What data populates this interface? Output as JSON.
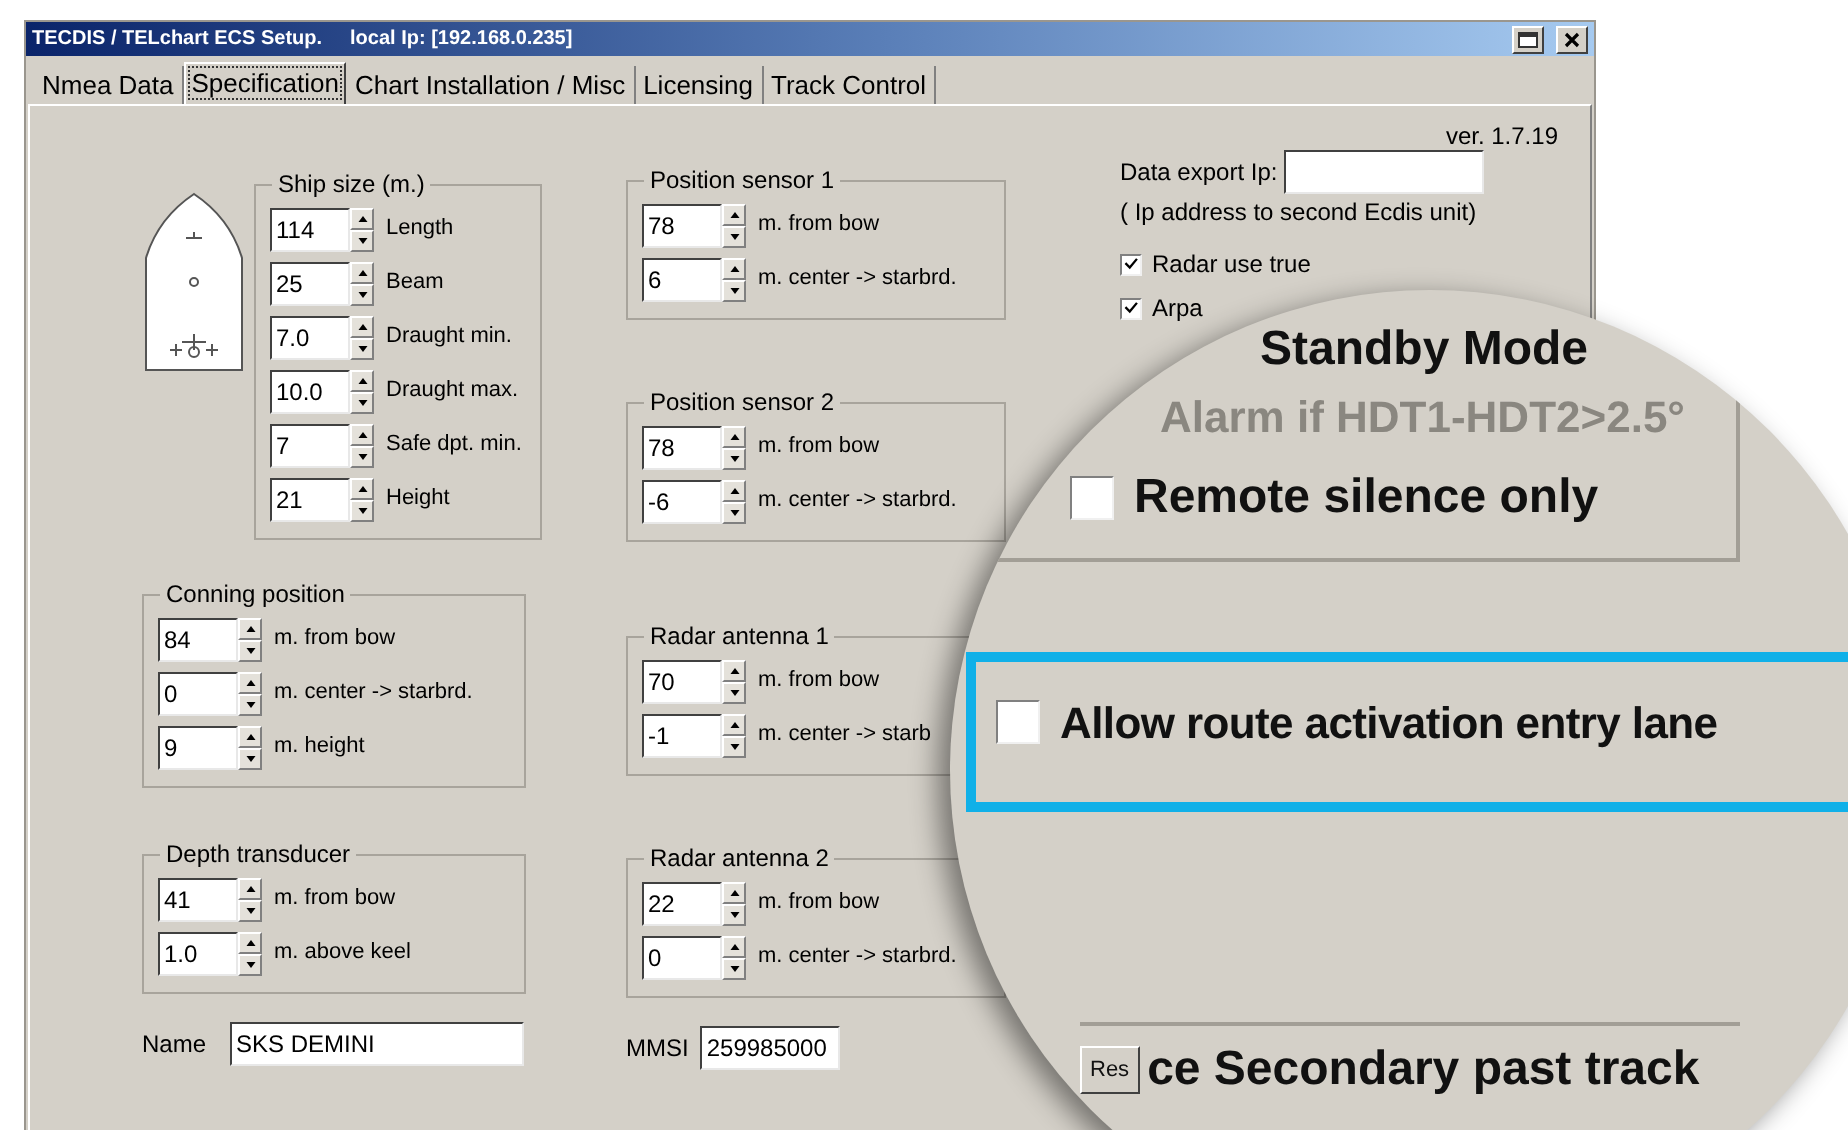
{
  "window": {
    "title": "TECDIS / TELchart ECS Setup.",
    "local_ip": "local Ip: [192.168.0.235]"
  },
  "tabs": [
    {
      "label": "Nmea Data",
      "selected": false
    },
    {
      "label": "Specification",
      "selected": true
    },
    {
      "label": "Chart Installation / Misc",
      "selected": false
    },
    {
      "label": "Licensing",
      "selected": false
    },
    {
      "label": "Track Control",
      "selected": false
    }
  ],
  "version": "ver. 1.7.19",
  "ship_size": {
    "title": "Ship size (m.)",
    "rows": [
      {
        "value": "114",
        "label": "Length"
      },
      {
        "value": "25",
        "label": "Beam"
      },
      {
        "value": "7.0",
        "label": "Draught min."
      },
      {
        "value": "10.0",
        "label": "Draught max."
      },
      {
        "value": "7",
        "label": "Safe dpt. min."
      },
      {
        "value": "21",
        "label": "Height"
      }
    ]
  },
  "left_groups": [
    {
      "title": "Conning position",
      "rows": [
        {
          "value": "84",
          "label": "m. from bow"
        },
        {
          "value": "0",
          "label": "m. center -> starbrd."
        },
        {
          "value": "9",
          "label": "m. height"
        }
      ]
    },
    {
      "title": "Depth transducer",
      "rows": [
        {
          "value": "41",
          "label": "m. from bow"
        },
        {
          "value": "1.0",
          "label": "m. above keel"
        }
      ]
    }
  ],
  "middle_groups": [
    {
      "title": "Position sensor 1",
      "rows": [
        {
          "value": "78",
          "label": "m. from bow"
        },
        {
          "value": "6",
          "label": "m. center -> starbrd."
        }
      ]
    },
    {
      "title": "Position sensor 2",
      "rows": [
        {
          "value": "78",
          "label": "m. from bow"
        },
        {
          "value": "-6",
          "label": "m. center -> starbrd."
        }
      ]
    },
    {
      "title": "Radar antenna 1",
      "rows": [
        {
          "value": "70",
          "label": "m. from bow"
        },
        {
          "value": "-1",
          "label": "m. center -> starb"
        }
      ]
    },
    {
      "title": "Radar antenna 2",
      "rows": [
        {
          "value": "22",
          "label": "m. from bow"
        },
        {
          "value": "0",
          "label": "m. center -> starbrd."
        }
      ]
    }
  ],
  "name_field": {
    "label": "Name",
    "value": "SKS DEMINI"
  },
  "mmsi_field": {
    "label": "MMSI",
    "value": "259985000"
  },
  "data_export": {
    "label": "Data export Ip:",
    "hint": "( Ip address to second Ecdis unit)"
  },
  "options": [
    {
      "label": "Radar use true",
      "checked": true
    },
    {
      "label": "Arpa",
      "checked": true
    }
  ],
  "magnifier": {
    "title": "Standby Mode",
    "alarm": {
      "label": "Alarm if HDT1-HDT2>2.5°",
      "disabled": true
    },
    "remote_silence": {
      "label": "Remote silence only",
      "checked": false
    },
    "route_entry": {
      "label": "Allow route activation entry lane",
      "checked": false,
      "highlighted": true
    },
    "reset_button": "Res",
    "secondary": "ce Secondary past track"
  }
}
